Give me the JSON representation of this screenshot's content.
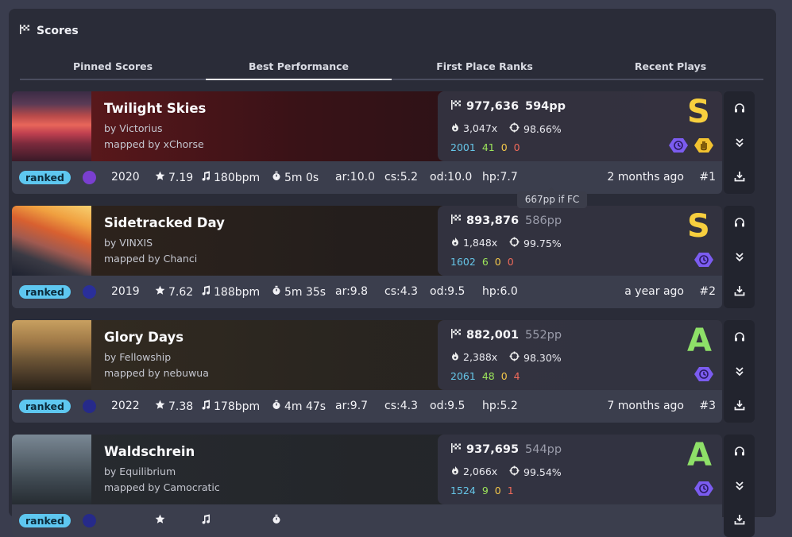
{
  "panel": {
    "title": "Scores"
  },
  "tabs": [
    {
      "label": "Pinned Scores",
      "active": false
    },
    {
      "label": "Best Performance",
      "active": true
    },
    {
      "label": "First Place Ranks",
      "active": false
    },
    {
      "label": "Recent Plays",
      "active": false
    }
  ],
  "scores": [
    {
      "title": "Twilight Skies",
      "artist": "by Victorius",
      "mapper": "mapped by xChorse",
      "score": "977,636",
      "pp": "594pp",
      "pp_style": "bright",
      "combo": "3,047x",
      "accuracy": "98.66%",
      "hits": {
        "great": "2001",
        "ok": "41",
        "meh": "0",
        "miss": "0"
      },
      "rank": "S",
      "mods": [
        "nightcore-icon",
        "hidden-icon"
      ],
      "status": "ranked",
      "diff_color": "#7a3fd0",
      "year": "2020",
      "stars": "7.19",
      "bpm": "180bpm",
      "length": "5m 0s",
      "ar": "ar:10.0",
      "cs": "cs:5.2",
      "od": "od:10.0",
      "hp": "hp:7.7",
      "ago": "2 months ago",
      "position": "#1"
    },
    {
      "title": "Sidetracked Day",
      "artist": "by VINXIS",
      "mapper": "mapped by Chanci",
      "score": "893,876",
      "pp": "586pp",
      "pp_style": "dim",
      "combo": "1,848x",
      "accuracy": "99.75%",
      "hits": {
        "great": "1602",
        "ok": "6",
        "meh": "0",
        "miss": "0"
      },
      "rank": "S",
      "mods": [
        "nightcore-icon"
      ],
      "status": "ranked",
      "diff_color": "#2a2f9a",
      "year": "2019",
      "stars": "7.62",
      "bpm": "188bpm",
      "length": "5m 35s",
      "ar": "ar:9.8",
      "cs": "cs:4.3",
      "od": "od:9.5",
      "hp": "hp:6.0",
      "ago": "a year ago",
      "position": "#2"
    },
    {
      "title": "Glory Days",
      "artist": "by Fellowship",
      "mapper": "mapped by nebuwua",
      "score": "882,001",
      "pp": "552pp",
      "pp_style": "dim",
      "combo": "2,388x",
      "accuracy": "98.30%",
      "hits": {
        "great": "2061",
        "ok": "48",
        "meh": "0",
        "miss": "4"
      },
      "rank": "A",
      "mods": [
        "nightcore-icon"
      ],
      "status": "ranked",
      "diff_color": "#262a8a",
      "year": "2022",
      "stars": "7.38",
      "bpm": "178bpm",
      "length": "4m 47s",
      "ar": "ar:9.7",
      "cs": "cs:4.3",
      "od": "od:9.5",
      "hp": "hp:5.2",
      "ago": "7 months ago",
      "position": "#3"
    },
    {
      "title": "Waldschrein",
      "artist": "by Equilibrium",
      "mapper": "mapped by Camocratic",
      "score": "937,695",
      "pp": "544pp",
      "pp_style": "dim",
      "combo": "2,066x",
      "accuracy": "99.54%",
      "hits": {
        "great": "1524",
        "ok": "9",
        "meh": "0",
        "miss": "1"
      },
      "rank": "A",
      "mods": [
        "nightcore-icon"
      ],
      "status": "ranked",
      "diff_color": "#262a8a",
      "year": "",
      "stars": "",
      "bpm": "",
      "length": "",
      "ar": "",
      "cs": "",
      "od": "",
      "hp": "",
      "ago": "",
      "position": ""
    }
  ],
  "tooltip": {
    "text": "667pp if FC"
  },
  "colors": {
    "ranked_badge": "#5ec7f0",
    "rank_S": "#f7cf3e",
    "rank_A": "#8ee068",
    "mod_purple": "#7b5cf0",
    "mod_gold": "#f2c230"
  }
}
